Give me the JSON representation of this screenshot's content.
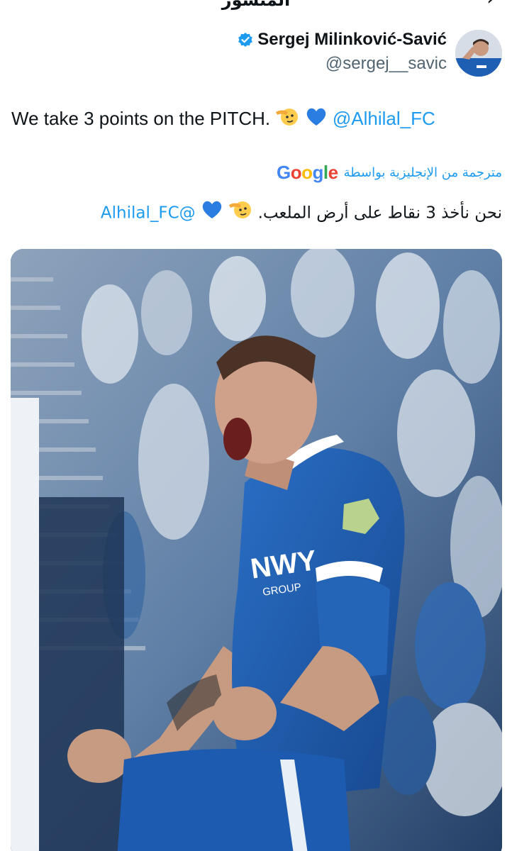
{
  "header": {
    "title": "المنشور",
    "more_label": "···",
    "back_label": "›"
  },
  "author": {
    "display_name": "Sergej Milinković-Savić",
    "handle": "@sergej__savic"
  },
  "tweet": {
    "text_before": "We take 3 points on the PITCH. ",
    "emoji": [
      "saluting-face",
      "blue-heart"
    ],
    "mention": "@Alhilal_FC"
  },
  "translation": {
    "label": "مترجمة من الإنجليزية بواسطة",
    "provider": "Google",
    "text": "نحن نأخذ 3 نقاط على أرض الملعب.",
    "mention": "@Alhilal_FC"
  },
  "media": {
    "jersey_sponsor": "NWY",
    "jersey_sponsor_sub": "GROUP",
    "accent_color": "#1d9bf0",
    "jersey_color": "#1f5fb3"
  }
}
